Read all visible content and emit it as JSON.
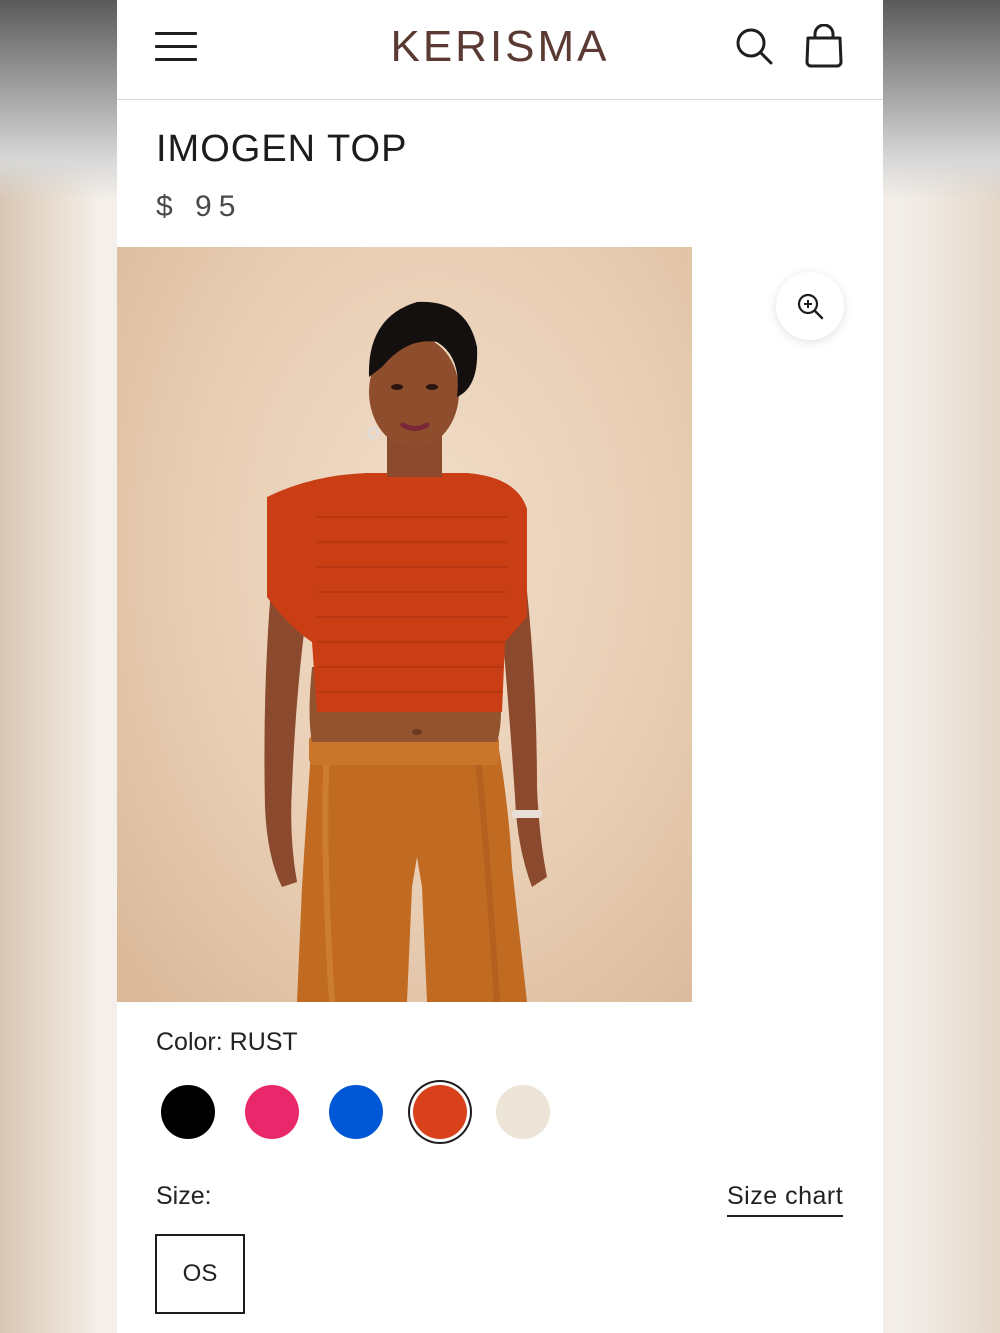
{
  "header": {
    "brand": "KERISMA",
    "icons": [
      "hamburger-menu-icon",
      "search-icon",
      "shopping-bag-icon"
    ]
  },
  "product": {
    "title": "IMOGEN TOP",
    "price": "$ 95"
  },
  "gallery": {
    "zoom_icon": "zoom-in-icon"
  },
  "color": {
    "label": "Color:",
    "selected": "RUST",
    "swatches": [
      {
        "color": "#000000"
      },
      {
        "color": "#e8286a"
      },
      {
        "color": "#0058d6"
      },
      {
        "color": "#d9401c",
        "selected": true
      },
      {
        "color": "#ece4d6"
      }
    ]
  },
  "size": {
    "label": "Size:",
    "chart_link": "Size chart",
    "options": [
      "OS"
    ]
  }
}
